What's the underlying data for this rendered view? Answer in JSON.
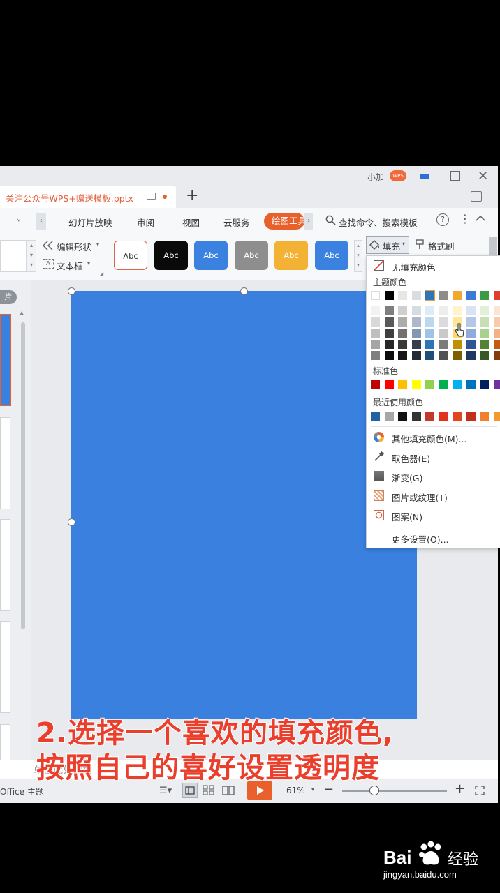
{
  "window": {
    "user_name": "小加",
    "user_badge": "WPS"
  },
  "tab": {
    "title": "关注公众号WPS+赠送模板.pptx"
  },
  "menu": {
    "items": [
      "幻灯片放映",
      "审阅",
      "视图",
      "云服务"
    ],
    "active": "绘图工具",
    "search": "查找命令、搜索模板"
  },
  "ribbon": {
    "edit_shape": "编辑形状",
    "text_box": "文本框",
    "style_sample": "Abc",
    "fill": "填充",
    "format_brush": "格式刷"
  },
  "left_panel": {
    "label": "片"
  },
  "fill_menu": {
    "no_fill": "无填充颜色",
    "theme_colors_label": "主题颜色",
    "standard_colors_label": "标准色",
    "recent_colors_label": "最近使用颜色",
    "theme_top_row": [
      "#ffffff",
      "#000000",
      "#e7e6e6",
      "#d9dde2",
      "#2e75b6",
      "#8c8c8c",
      "#f0a830",
      "#3b7ad5",
      "#3a9a47",
      "#dd3f2f"
    ],
    "theme_columns": [
      [
        "#f2f2f2",
        "#d8d8d8",
        "#bfbfbf",
        "#a5a5a5",
        "#7f7f7f"
      ],
      [
        "#7f7f7f",
        "#595959",
        "#3f3f3f",
        "#262626",
        "#0c0c0c"
      ],
      [
        "#d0cece",
        "#aeabab",
        "#757070",
        "#3a3838",
        "#171616"
      ],
      [
        "#d6dce4",
        "#adb9ca",
        "#8497b0",
        "#333f50",
        "#222a35"
      ],
      [
        "#deebf7",
        "#bdd7ee",
        "#9dc3e6",
        "#2e75b6",
        "#1f4e79"
      ],
      [
        "#ededed",
        "#dbdbdb",
        "#c9c9c9",
        "#7b7b7b",
        "#525252"
      ],
      [
        "#fff2cc",
        "#ffe699",
        "#ffd966",
        "#bf8f00",
        "#7f6000"
      ],
      [
        "#dae3f3",
        "#b4c7e7",
        "#8faadc",
        "#2f5597",
        "#203864"
      ],
      [
        "#e2f0d9",
        "#c5e0b4",
        "#a9d18e",
        "#548235",
        "#385723"
      ],
      [
        "#fbe5d6",
        "#f8cbad",
        "#f4b183",
        "#c55a11",
        "#843c0c"
      ]
    ],
    "standard_colors": [
      "#c00000",
      "#ff0000",
      "#ffc000",
      "#ffff00",
      "#92d050",
      "#00b050",
      "#00b0f0",
      "#0070c0",
      "#002060",
      "#7030a0"
    ],
    "recent_colors": [
      "#1f62a6",
      "#a6a6a6",
      "#111111",
      "#333333",
      "#c0392b",
      "#e0331f",
      "#e0471f",
      "#c0301c",
      "#f08030",
      "#f29a2e"
    ],
    "more_fill": "其他填充颜色(M)...",
    "eyedropper": "取色器(E)",
    "gradient": "渐变(G)",
    "picture_texture": "图片或纹理(T)",
    "pattern": "图案(N)",
    "more_settings": "更多设置(O)..."
  },
  "notes": {
    "placeholder": "单击此处添加"
  },
  "status": {
    "theme": "Office 主题",
    "zoom": "61%",
    "zoom_fraction": 0.3
  },
  "caption": {
    "line1": "2.选择一个喜欢的填充颜色,",
    "line2": "按照自己的喜好设置透明度"
  },
  "watermark": {
    "brand": "Bai",
    "brand_cn": "经验",
    "url": "jingyan.baidu.com"
  }
}
